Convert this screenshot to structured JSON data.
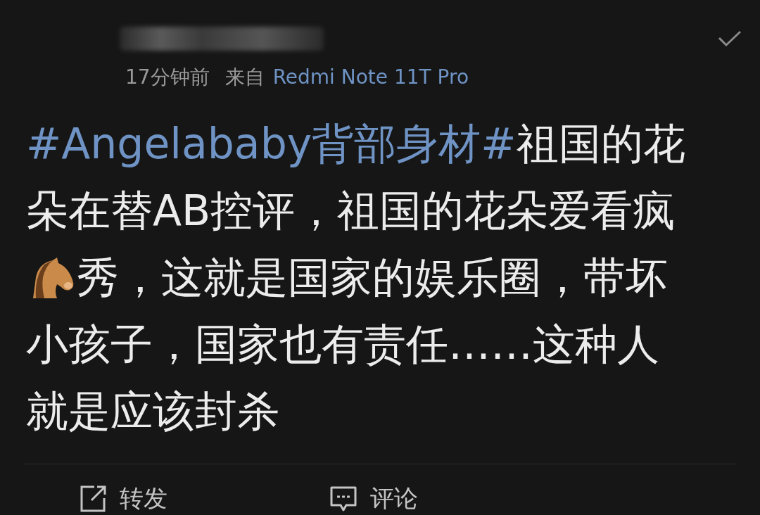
{
  "post": {
    "time": "17分钟前",
    "source_label": "来自",
    "source_device": "Redmi Note 11T Pro",
    "lines": [
      [
        {
          "kind": "hashtag",
          "text": "#Angelababy背部身材#"
        },
        {
          "kind": "text",
          "text": " 祖国的花"
        }
      ],
      [
        {
          "kind": "text",
          "text": "朵在替AB控评，祖国的花朵爱看疯"
        }
      ],
      [
        {
          "kind": "horse"
        },
        {
          "kind": "text",
          "text": "秀，这就是国家的娱乐圈，带坏"
        }
      ],
      [
        {
          "kind": "text",
          "text": "小孩子，国家也有责任……这种人"
        }
      ],
      [
        {
          "kind": "text",
          "text": "就是应该封杀"
        }
      ]
    ]
  },
  "actions": [
    {
      "kind": "repost",
      "label": "转发"
    },
    {
      "kind": "comment",
      "label": "评论"
    }
  ]
}
